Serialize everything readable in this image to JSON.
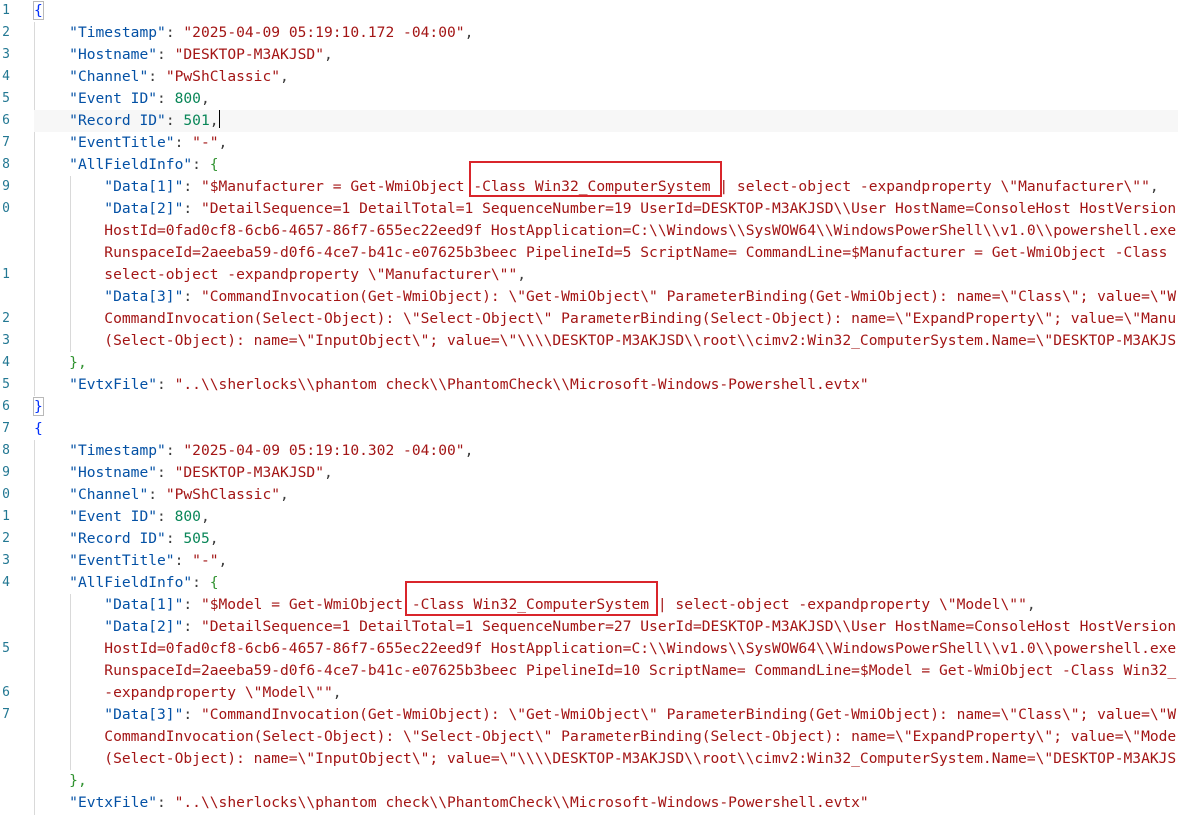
{
  "gutter": {
    "line_numbers": [
      "1",
      "2",
      "3",
      "4",
      "5",
      "6",
      "7",
      "8",
      "9",
      "0",
      "",
      "",
      "1",
      "",
      "2",
      "3",
      "4",
      "5",
      "6",
      "7",
      "8",
      "9",
      "0",
      "1",
      "2",
      "3",
      "4",
      "",
      "",
      "5",
      "",
      "6",
      "7"
    ]
  },
  "record1": {
    "open_brace": "{",
    "timestamp_key": "\"Timestamp\"",
    "timestamp_val": "\"2025-04-09 05:19:10.172 -04:00\"",
    "hostname_key": "\"Hostname\"",
    "hostname_val": "\"DESKTOP-M3AKJSD\"",
    "channel_key": "\"Channel\"",
    "channel_val": "\"PwShClassic\"",
    "eventid_key": "\"Event ID\"",
    "eventid_val": "800",
    "recordid_key": "\"Record ID\"",
    "recordid_val": "501",
    "eventtitle_key": "\"EventTitle\"",
    "eventtitle_val": "\"-\"",
    "allfield_key": "\"AllFieldInfo\"",
    "data1_key": "\"Data[1]\"",
    "data1_val": "\"$Manufacturer = Get-WmiObject -Class Win32_ComputerSystem | select-object -expandproperty \\\"Manufacturer\\\"\"",
    "data2_key": "\"Data[2]\"",
    "data2_l1": "\"DetailSequence=1 DetailTotal=1 SequenceNumber=19 UserId=DESKTOP-M3AKJSD\\\\User HostName=ConsoleHost HostVersion",
    "data2_l2": "HostId=0fad0cf8-6cb6-4657-86f7-655ec22eed9f HostApplication=C:\\\\Windows\\\\SysWOW64\\\\WindowsPowerShell\\\\v1.0\\\\powershell.exe",
    "data2_l3": "RunspaceId=2aeeba59-d0f6-4ce7-b41c-e07625b3beec PipelineId=5 ScriptName= CommandLine=$Manufacturer = Get-WmiObject -Class",
    "data2_l4": "select-object -expandproperty \\\"Manufacturer\\\"\"",
    "data3_key": "\"Data[3]\"",
    "data3_l1": "\"CommandInvocation(Get-WmiObject): \\\"Get-WmiObject\\\" ParameterBinding(Get-WmiObject): name=\\\"Class\\\"; value=\\\"W",
    "data3_l2": "CommandInvocation(Select-Object): \\\"Select-Object\\\" ParameterBinding(Select-Object): name=\\\"ExpandProperty\\\"; value=\\\"Manu",
    "data3_l3": "(Select-Object): name=\\\"InputObject\\\"; value=\\\"\\\\\\\\DESKTOP-M3AKJSD\\\\root\\\\cimv2:Win32_ComputerSystem.Name=\\\"DESKTOP-M3AKJS",
    "evtx_key": "\"EvtxFile\"",
    "evtx_val": "\"..\\\\sherlocks\\\\phantom check\\\\PhantomCheck\\\\Microsoft-Windows-Powershell.evtx\""
  },
  "record2": {
    "open_brace": "{",
    "timestamp_key": "\"Timestamp\"",
    "timestamp_val": "\"2025-04-09 05:19:10.302 -04:00\"",
    "hostname_key": "\"Hostname\"",
    "hostname_val": "\"DESKTOP-M3AKJSD\"",
    "channel_key": "\"Channel\"",
    "channel_val": "\"PwShClassic\"",
    "eventid_key": "\"Event ID\"",
    "eventid_val": "800",
    "recordid_key": "\"Record ID\"",
    "recordid_val": "505",
    "eventtitle_key": "\"EventTitle\"",
    "eventtitle_val": "\"-\"",
    "allfield_key": "\"AllFieldInfo\"",
    "data1_key": "\"Data[1]\"",
    "data1_val": "\"$Model = Get-WmiObject -Class Win32_ComputerSystem | select-object -expandproperty \\\"Model\\\"\"",
    "data2_key": "\"Data[2]\"",
    "data2_l1": "\"DetailSequence=1 DetailTotal=1 SequenceNumber=27 UserId=DESKTOP-M3AKJSD\\\\User HostName=ConsoleHost HostVersion",
    "data2_l2": "HostId=0fad0cf8-6cb6-4657-86f7-655ec22eed9f HostApplication=C:\\\\Windows\\\\SysWOW64\\\\WindowsPowerShell\\\\v1.0\\\\powershell.exe",
    "data2_l3": "RunspaceId=2aeeba59-d0f6-4ce7-b41c-e07625b3beec PipelineId=10 ScriptName= CommandLine=$Model = Get-WmiObject -Class Win32_",
    "data2_l4": "-expandproperty \\\"Model\\\"\"",
    "data3_key": "\"Data[3]\"",
    "data3_l1": "\"CommandInvocation(Get-WmiObject): \\\"Get-WmiObject\\\" ParameterBinding(Get-WmiObject): name=\\\"Class\\\"; value=\\\"W",
    "data3_l2": "CommandInvocation(Select-Object): \\\"Select-Object\\\" ParameterBinding(Select-Object): name=\\\"ExpandProperty\\\"; value=\\\"Mode",
    "data3_l3": "(Select-Object): name=\\\"InputObject\\\"; value=\\\"\\\\\\\\DESKTOP-M3AKJSD\\\\root\\\\cimv2:Win32_ComputerSystem.Name=\\\"DESKTOP-M3AKJS",
    "evtx_key": "\"EvtxFile\"",
    "evtx_val": "\"..\\\\sherlocks\\\\phantom check\\\\PhantomCheck\\\\Microsoft-Windows-Powershell.evtx\""
  },
  "punct": {
    "colon": ": ",
    "comma": ",",
    "open_brace": "{",
    "close_brace": "}",
    "close_brace_comma": "},"
  },
  "colors": {
    "key": "#0451a5",
    "string": "#a31515",
    "number": "#098658",
    "line_number": "#237893",
    "highlight_box": "#d9252b"
  }
}
